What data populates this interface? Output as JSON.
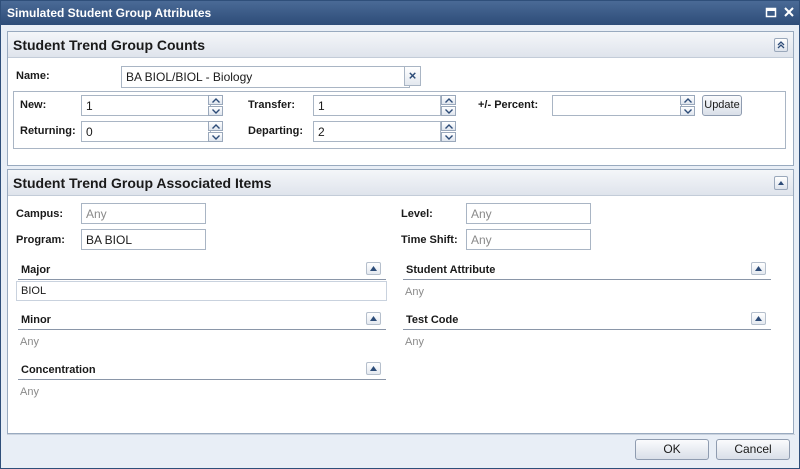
{
  "window": {
    "title": "Simulated Student Group Attributes"
  },
  "counts_panel": {
    "title": "Student Trend Group Counts",
    "name_label": "Name:",
    "name_value": "BA BIOL/BIOL - Biology",
    "clear_symbol": "×",
    "new_label": "New:",
    "new_value": "1",
    "transfer_label": "Transfer:",
    "transfer_value": "1",
    "percent_label": "+/- Percent:",
    "percent_value": "",
    "update_label": "Update",
    "returning_label": "Returning:",
    "returning_value": "0",
    "departing_label": "Departing:",
    "departing_value": "2"
  },
  "items_panel": {
    "title": "Student Trend Group Associated Items",
    "campus_label": "Campus:",
    "campus_value": "Any",
    "program_label": "Program:",
    "program_value": "BA BIOL",
    "level_label": "Level:",
    "level_value": "Any",
    "timeshift_label": "Time Shift:",
    "timeshift_value": "Any",
    "major": {
      "title": "Major",
      "value": "BIOL"
    },
    "minor": {
      "title": "Minor",
      "value": "Any"
    },
    "concentration": {
      "title": "Concentration",
      "value": "Any"
    },
    "student_attribute": {
      "title": "Student Attribute",
      "value": "Any"
    },
    "test_code": {
      "title": "Test Code",
      "value": "Any"
    }
  },
  "footer": {
    "ok_label": "OK",
    "cancel_label": "Cancel"
  }
}
